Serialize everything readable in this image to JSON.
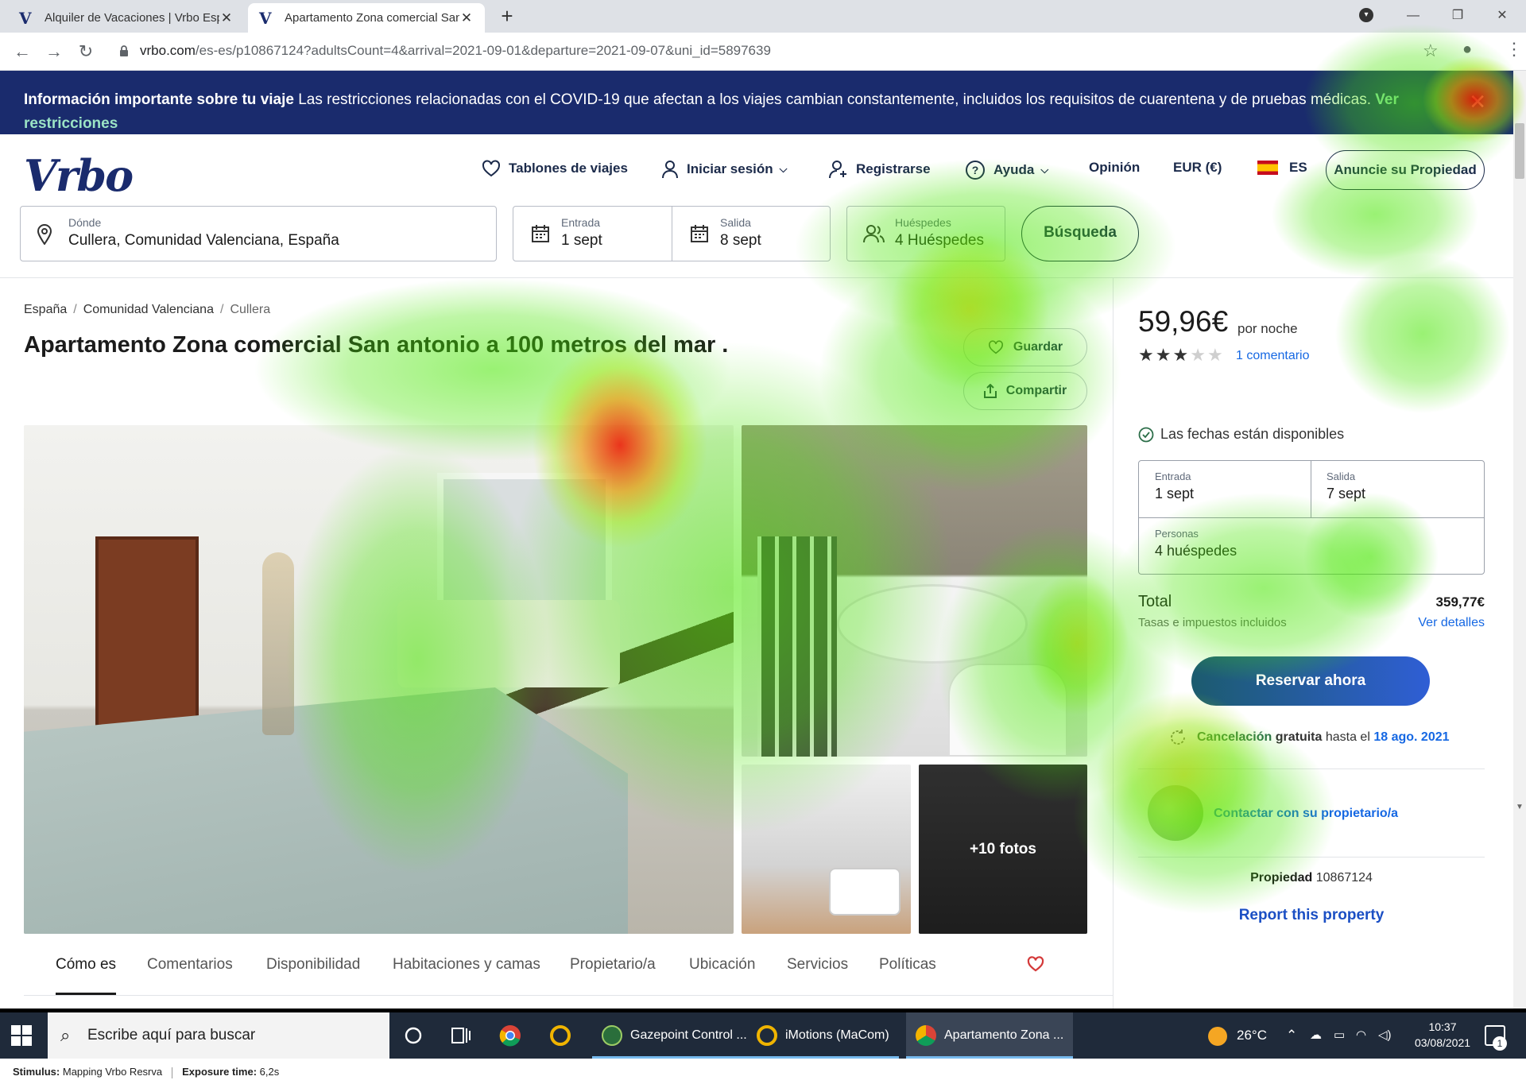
{
  "browser": {
    "tabs": [
      {
        "title": "Alquiler de Vacaciones | Vrbo Esp",
        "active": false
      },
      {
        "title": "Apartamento Zona comercial San",
        "active": true
      }
    ],
    "url_host": "vrbo.com",
    "url_path": "/es-es/p10867124?adultsCount=4&arrival=2021-09-01&departure=2021-09-07&uni_id=5897639"
  },
  "banner": {
    "bold": "Información importante sobre tu viaje",
    "text": " Las restricciones relacionadas con el COVID-19 que afectan a los viajes cambian constantemente, incluidos los requisitos de cuarentena y de pruebas médicas. ",
    "link": "Ver restricciones"
  },
  "header": {
    "logo": "Vrbo",
    "trip_boards": "Tablones de viajes",
    "login": "Iniciar sesión",
    "register": "Registrarse",
    "help": "Ayuda",
    "feedback": "Opinión",
    "currency": "EUR (€)",
    "language": "ES",
    "advertise": "Anuncie su Propiedad"
  },
  "search": {
    "where_label": "Dónde",
    "where_value": "Cullera, Comunidad Valenciana, España",
    "checkin_label": "Entrada",
    "checkin_value": "1 sept",
    "checkout_label": "Salida",
    "checkout_value": "8 sept",
    "guests_label": "Huéspedes",
    "guests_value": "4 Huéspedes",
    "button": "Búsqueda"
  },
  "breadcrumb": [
    "España",
    "Comunidad Valenciana",
    "Cullera"
  ],
  "listing": {
    "title": "Apartamento Zona comercial San antonio a 100 metros del mar .",
    "save": "Guardar",
    "share": "Compartir",
    "more_photos": "+10 fotos"
  },
  "section_tabs": [
    "Cómo es",
    "Comentarios",
    "Disponibilidad",
    "Habitaciones y camas",
    "Propietario/a",
    "Ubicación",
    "Servicios",
    "Políticas"
  ],
  "booking": {
    "price": "59,96€",
    "per_night": "por noche",
    "rating": 3,
    "rating_max": 5,
    "reviews": "1 comentario",
    "available": "Las fechas están disponibles",
    "checkin_label": "Entrada",
    "checkin_value": "1 sept",
    "checkout_label": "Salida",
    "checkout_value": "7 sept",
    "guests_label": "Personas",
    "guests_value": "4 huéspedes",
    "total_label": "Total",
    "total_value": "359,77€",
    "taxes": "Tasas e impuestos incluidos",
    "details": "Ver detalles",
    "reserve": "Reservar ahora",
    "cancel_green": "Cancelación",
    "cancel_bold": "gratuita",
    "cancel_text": "hasta el",
    "cancel_date": "18 ago. 2021",
    "contact": "Contactar con su propietario/a",
    "property_label": "Propiedad",
    "property_id": "10867124",
    "report": "Report this property"
  },
  "taskbar": {
    "search_placeholder": "Escribe aquí para buscar",
    "apps": [
      "Gazepoint Control ...",
      "iMotions (MaCom)",
      "Apartamento Zona ..."
    ],
    "temperature": "26°C",
    "time": "10:37",
    "date": "03/08/2021",
    "notifications": "1"
  },
  "status_strip": {
    "stimulus_label": "Stimulus:",
    "stimulus_value": "Mapping Vrbo Resrva",
    "exposure_label": "Exposure time:",
    "exposure_value": "6,2s"
  },
  "colors": {
    "brand_navy": "#1a2b6d",
    "link_blue": "#1668e3",
    "banner_link": "#9be3c5",
    "reserve_start": "#1c5b6e",
    "reserve_end": "#2f5ed5"
  }
}
